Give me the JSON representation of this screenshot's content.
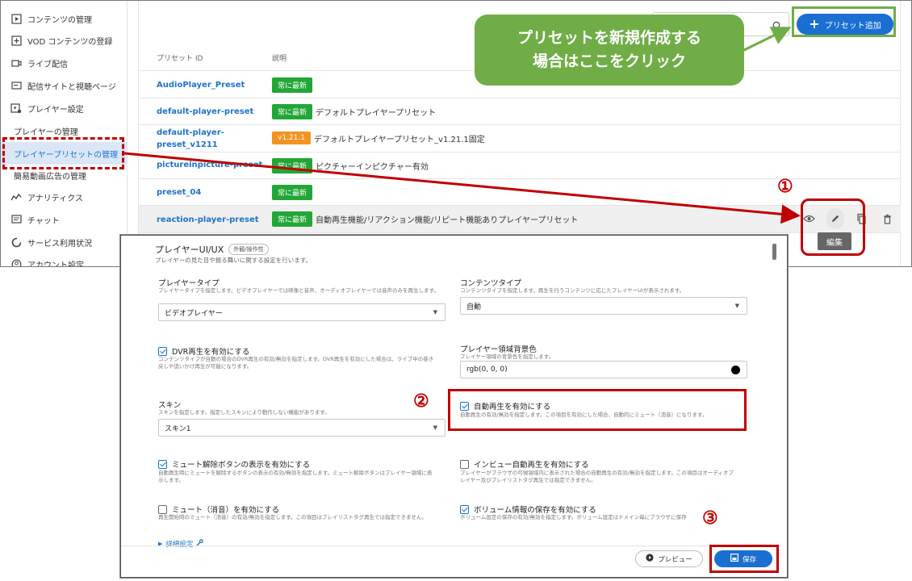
{
  "sidebar": {
    "items": [
      {
        "label": "コンテンツの管理",
        "icon": "play-square-icon"
      },
      {
        "label": "VOD コンテンツの登録",
        "icon": "add-square-icon"
      },
      {
        "label": "ライブ配信",
        "icon": "camera-icon"
      },
      {
        "label": "配信サイトと視聴ページ",
        "icon": "monitor-icon"
      },
      {
        "label": "プレイヤー設定",
        "icon": "player-settings-icon"
      },
      {
        "label": "プレイヤーの管理",
        "icon": ""
      },
      {
        "label": "プレイヤープリセットの管理",
        "icon": ""
      },
      {
        "label": "簡易動画広告の管理",
        "icon": ""
      },
      {
        "label": "アナリティクス",
        "icon": "analytics-icon"
      },
      {
        "label": "チャット",
        "icon": "chat-icon"
      },
      {
        "label": "サービス利用状況",
        "icon": "usage-icon"
      },
      {
        "label": "アカウント設定",
        "icon": "account-icon"
      }
    ]
  },
  "toolbar": {
    "add_preset_label": "プリセット追加"
  },
  "table": {
    "headers": {
      "id": "プリセット ID",
      "description": "説明"
    },
    "rows": [
      {
        "id": "AudioPlayer_Preset",
        "badge": "常に最新",
        "desc": ""
      },
      {
        "id": "default-player-preset",
        "badge": "常に最新",
        "desc": "デフォルトプレイヤープリセット"
      },
      {
        "id_line1": "default-player-",
        "id_line2": "preset_v1211",
        "badge": "v1.21.1",
        "desc": "デフォルトプレイヤープリセット_v1.21.1固定"
      },
      {
        "id": "pictureinpicture-preset",
        "badge": "常に最新",
        "desc": "ピクチャーインピクチャー有効"
      },
      {
        "id": "preset_04",
        "badge": "常に最新",
        "desc": ""
      },
      {
        "id": "reaction-player-preset",
        "badge": "常に最新",
        "desc": "自動再生機能/リアクション機能/リピート機能ありプレイヤープリセット"
      }
    ],
    "edit_tooltip": "編集"
  },
  "callout": {
    "line1": "プリセットを新規作成する",
    "line2": "場合はここをクリック"
  },
  "markers": {
    "one": "①",
    "two": "②",
    "three": "③"
  },
  "editor": {
    "section_title": "プレイヤーUI/UX",
    "section_tag": "外観/操作性",
    "section_sub": "プレイヤーの見た目や振る舞いに関する設定を行います。",
    "player_type": {
      "label": "プレイヤータイプ",
      "help": "プレイヤータイプを指定します。ビデオプレイヤーでは映像と音声、オーディオプレイヤーでは音声のみを再生します。",
      "value": "ビデオプレイヤー"
    },
    "content_type": {
      "label": "コンテンツタイプ",
      "help": "コンテンツタイプを指定します。再生を行うコンテンツに応じたプレイヤーUIが表示されます。",
      "value": "自動"
    },
    "dvr": {
      "label": "DVR再生を有効にする",
      "help1": "コンテンツタイプが自動の場合のDVR再生の有効/無効を指定します。DVR再生を有効にした場合は、ライブ中の巻き",
      "help2": "戻しや追いかけ再生が可能になります。"
    },
    "bg_color": {
      "label": "プレイヤー領域背景色",
      "help": "プレイヤー領域の背景色を指定します。",
      "value": "rgb(0, 0, 0)"
    },
    "skin": {
      "label": "スキン",
      "help": "スキンを指定します。指定したスキンにより動作しない機能があります。",
      "value": "スキン1"
    },
    "autoplay": {
      "label": "自動再生を有効にする",
      "help": "自動再生の有効/無効を指定します。この項目を有効にした場合、自動的にミュート（消音）になります。"
    },
    "unmute_button": {
      "label": "ミュート解除ボタンの表示を有効にする",
      "help1": "自動再生時にミュートを解除するボタンの表示の有効/無効を指定します。ミュート解除ボタンはプレイヤー領域に表",
      "help2": "示します。"
    },
    "inview_autoplay": {
      "label": "インビュー自動再生を有効にする",
      "help1": "プレイヤーがブラウザの可視領域内に表示された場合の自動再生の有効/無効を指定します。この項目はオーディオプ",
      "help2": "レイヤー及びプレイリストタグ再生では指定できません。"
    },
    "mute": {
      "label": "ミュート（消音）を有効にする",
      "help": "再生開始時のミュート（消音）の有効/無効を指定します。この項目はプレイリストタグ再生では指定できません。"
    },
    "volume_save": {
      "label": "ボリューム情報の保存を有効にする",
      "help": "ボリューム設定の保存の有効/無効を指定します。ボリューム設定はドメイン毎にブラウザに保存"
    },
    "advanced_link": "詳細設定",
    "preview_label": "プレビュー",
    "save_label": "保存"
  },
  "colors": {
    "accent": "#1a6fd1",
    "badge_green": "#22a637",
    "badge_orange": "#f39422",
    "highlight_red": "#c00000",
    "callout_green": "#70ad47"
  }
}
